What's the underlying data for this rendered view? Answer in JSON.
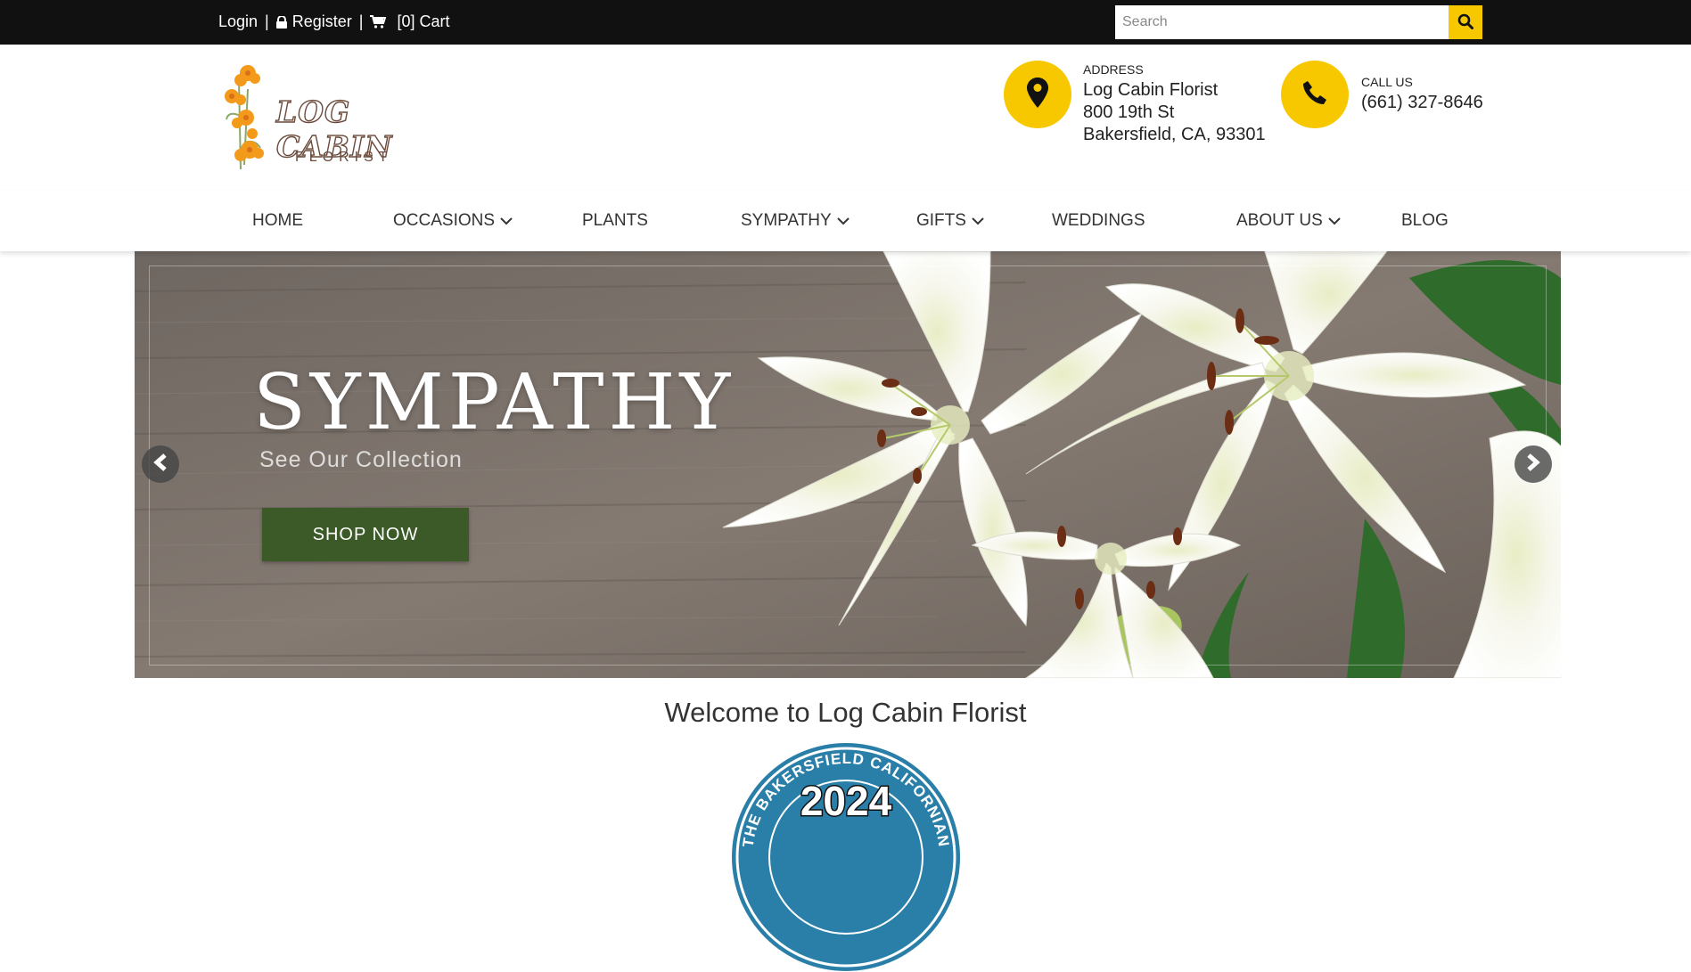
{
  "topbar": {
    "login_label": "Login",
    "separator": "|",
    "register_label": "Register",
    "cart_label": "[0] Cart",
    "search": {
      "placeholder": "Search",
      "value": ""
    }
  },
  "header": {
    "logo": {
      "word_top": "LOG CABIN",
      "word_bottom": "FLORIST"
    },
    "address": {
      "label": "ADDRESS",
      "lines": [
        "Log Cabin Florist",
        "800 19th St",
        "Bakersfield, CA, 93301"
      ]
    },
    "phone": {
      "label": "CALL US",
      "number": "(661) 327-8646"
    }
  },
  "nav": {
    "items": [
      {
        "label": "HOME",
        "has_dropdown": false
      },
      {
        "label": "OCCASIONS",
        "has_dropdown": true
      },
      {
        "label": "PLANTS",
        "has_dropdown": false
      },
      {
        "label": "SYMPATHY",
        "has_dropdown": true
      },
      {
        "label": "GIFTS",
        "has_dropdown": true
      },
      {
        "label": "WEDDINGS",
        "has_dropdown": false
      },
      {
        "label": "ABOUT US",
        "has_dropdown": true
      },
      {
        "label": "BLOG",
        "has_dropdown": false
      }
    ]
  },
  "hero": {
    "title": "SYMPATHY",
    "subtitle": "See Our Collection",
    "cta_label": "SHOP NOW"
  },
  "welcome": {
    "heading": "Welcome to Log Cabin Florist"
  },
  "badge": {
    "top_text": "THE BAKERSFIELD CALIFORNIAN",
    "year": "2024"
  },
  "colors": {
    "topbar_bg": "#111111",
    "accent_yellow": "#f7c800",
    "cta_green": "#3b5a28",
    "text_dark": "#222222",
    "badge_blue": "#2a7fa8"
  },
  "icons": {
    "lock": "lock-icon",
    "cart": "cart-icon",
    "search": "search-icon",
    "address": "map-pin-icon",
    "phone": "phone-icon",
    "dropdown": "chevron-down-icon",
    "prev": "chevron-left-icon",
    "next": "chevron-right-icon"
  }
}
